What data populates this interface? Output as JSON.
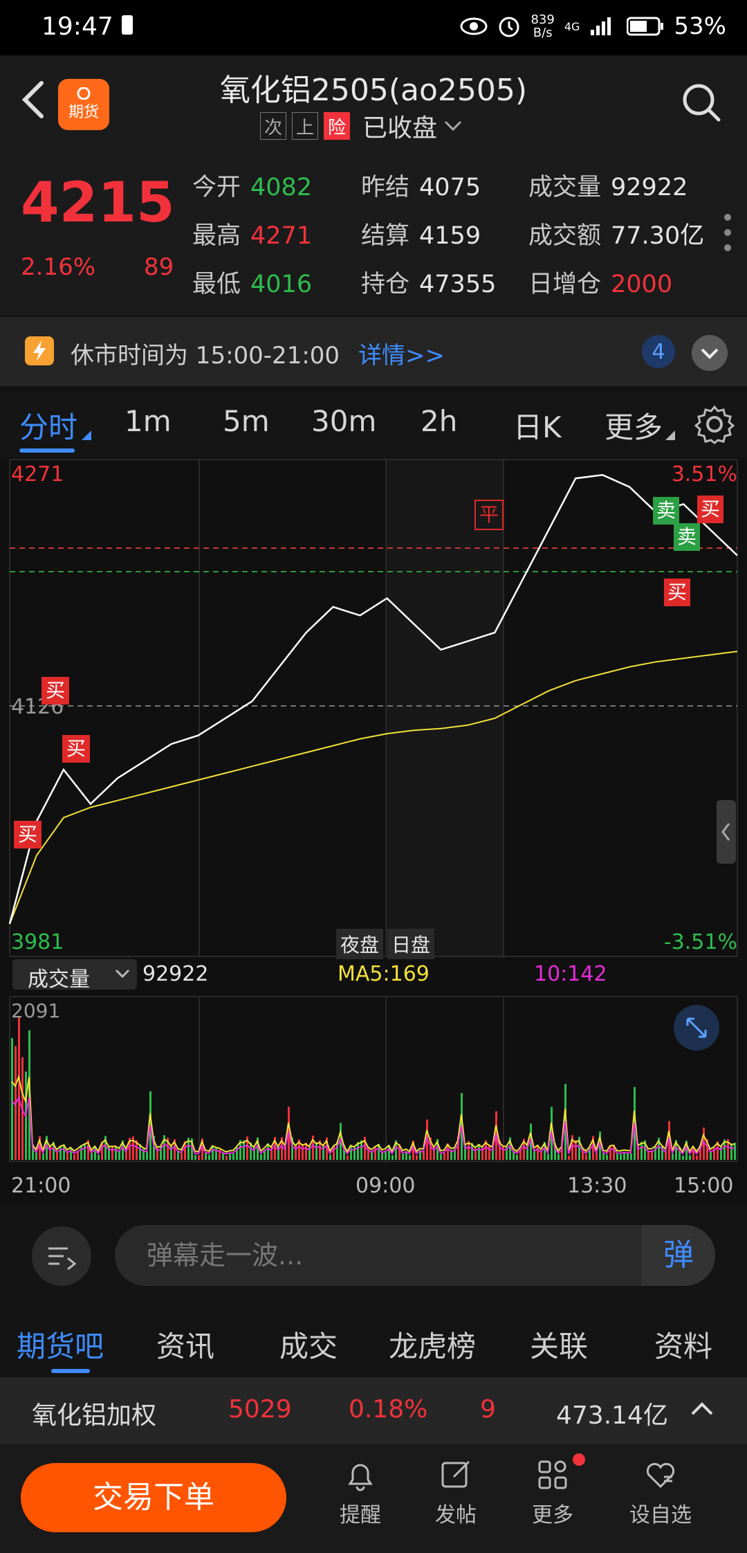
{
  "status_bar": {
    "time": "19:47",
    "net_speed_value": "839",
    "net_speed_unit": "B/s",
    "network": "4G",
    "battery": "53%"
  },
  "header": {
    "title": "氧化铝2505(ao2505)",
    "logo_text": "期货",
    "tags": [
      "次",
      "上"
    ],
    "risk_tag": "险",
    "status": "已收盘"
  },
  "quote": {
    "price": "4215",
    "change_pct": "2.16%",
    "change": "89",
    "fields": [
      {
        "label": "今开",
        "value": "4082",
        "color": "green"
      },
      {
        "label": "昨结",
        "value": "4075",
        "color": "white"
      },
      {
        "label": "成交量",
        "value": "92922",
        "color": "white"
      },
      {
        "label": "最高",
        "value": "4271",
        "color": "red"
      },
      {
        "label": "结算",
        "value": "4159",
        "color": "white"
      },
      {
        "label": "成交额",
        "value": "77.30亿",
        "color": "white"
      },
      {
        "label": "最低",
        "value": "4016",
        "color": "green"
      },
      {
        "label": "持仓",
        "value": "47355",
        "color": "white"
      },
      {
        "label": "日增仓",
        "value": "2000",
        "color": "red"
      }
    ]
  },
  "notice": {
    "text": "休市时间为 15:00-21:00",
    "link": "详情>>",
    "badge": "4"
  },
  "tabs": [
    "分时",
    "1m",
    "5m",
    "30m",
    "2h",
    "日K",
    "更多"
  ],
  "chart": {
    "y_top_label": "4271",
    "y_bottom_label": "3981",
    "y_mid_label": "4126",
    "pct_top": "3.51%",
    "pct_bottom": "-3.51%",
    "session_labels": [
      "夜盘",
      "日盘"
    ],
    "volume_label": "成交量",
    "volume_value": "92922",
    "ma5": "MA5:169",
    "ma10": "10:142",
    "vol_max": "2091",
    "x_labels": [
      "21:00",
      "09:00",
      "13:30",
      "15:00"
    ],
    "markers": [
      "买",
      "买",
      "买",
      "平",
      "卖",
      "卖",
      "买",
      "买"
    ],
    "colors": {
      "price_line": "#ffffff",
      "avg_line": "#f3e23a",
      "up": "#f2323b",
      "down": "#2ebd4e",
      "ma10": "#e62cd8"
    }
  },
  "chart_data": {
    "type": "line",
    "series": [
      {
        "values": [
          4000,
          4060,
          4090,
          4070,
          4085,
          4095,
          4105,
          4110,
          4120,
          4130,
          4150,
          4170,
          4185,
          4180,
          4190,
          4175,
          4160,
          4165,
          4170,
          4200,
          4230,
          4260,
          4262,
          4255,
          4240,
          4245,
          4230,
          4215
        ]
      },
      {
        "values": [
          4000,
          4040,
          4062,
          4068,
          4072,
          4076,
          4080,
          4084,
          4088,
          4092,
          4096,
          4100,
          4104,
          4108,
          4111,
          4113,
          4114,
          4116,
          4120,
          4128,
          4136,
          4142,
          4146,
          4150,
          4153,
          4155,
          4157,
          4159
        ]
      }
    ],
    "ylim": [
      3981,
      4271
    ]
  },
  "danmu": {
    "placeholder": "弹幕走一波...",
    "button": "弹"
  },
  "subtabs": [
    "期货吧",
    "资讯",
    "成交",
    "龙虎榜",
    "关联",
    "资料"
  ],
  "weighted": {
    "name": "氧化铝加权",
    "price": "5029",
    "pct": "0.18%",
    "change": "9",
    "amount": "473.14亿"
  },
  "actions": {
    "trade": "交易下单",
    "items": [
      "提醒",
      "发帖",
      "更多",
      "设自选"
    ]
  }
}
